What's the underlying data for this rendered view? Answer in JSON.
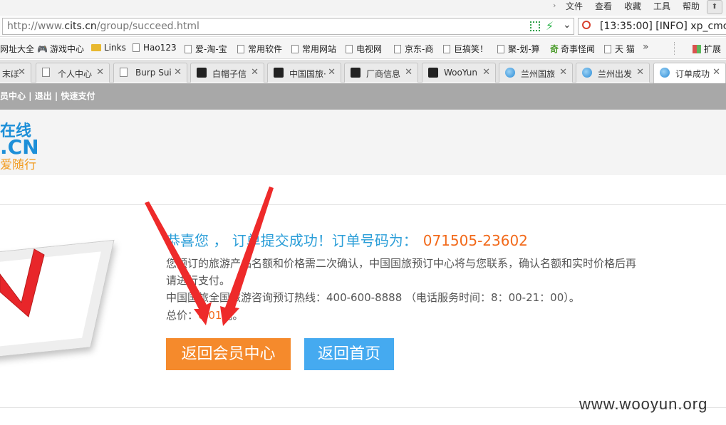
{
  "menu": {
    "items": [
      "文件",
      "查看",
      "收藏",
      "工具",
      "帮助"
    ]
  },
  "address": {
    "url_prefix": "http://www.",
    "url_domain": "cits.cn",
    "url_path": "/group/succeed.html",
    "search_text": "[13:35:00] [INFO] xp_cmc"
  },
  "bookmarks": {
    "items": [
      {
        "label": "网址大全",
        "icon": "none"
      },
      {
        "label": "游戏中心",
        "icon": "gamepad-icon"
      },
      {
        "label": "Links",
        "icon": "folder-icon"
      },
      {
        "label": "Hao123",
        "icon": "page-icon"
      },
      {
        "label": "爱-淘-宝",
        "icon": "page-icon"
      },
      {
        "label": "常用软件",
        "icon": "page-icon"
      },
      {
        "label": "常用网站",
        "icon": "page-icon"
      },
      {
        "label": "电视网",
        "icon": "page-icon"
      },
      {
        "label": "京东-商",
        "icon": "page-icon"
      },
      {
        "label": "巨搞笑！",
        "icon": "page-icon"
      },
      {
        "label": "聚-划-算",
        "icon": "page-icon"
      },
      {
        "label": "奇事怪闻",
        "icon": "qishi-icon"
      },
      {
        "label": "天 猫",
        "icon": "page-icon"
      }
    ],
    "more": "»",
    "extension_label": "扩展"
  },
  "tabs": [
    {
      "label": "末ぼ",
      "icon": "none",
      "active": false
    },
    {
      "label": "个人中心",
      "icon": "page-icon",
      "active": false
    },
    {
      "label": "Burp Sui",
      "icon": "page-icon",
      "active": false
    },
    {
      "label": "白帽子信",
      "icon": "wooyun-icon",
      "active": false
    },
    {
      "label": "中国国旅·",
      "icon": "wooyun-icon",
      "active": false
    },
    {
      "label": "厂商信息",
      "icon": "wooyun-icon",
      "active": false
    },
    {
      "label": "WooYun",
      "icon": "wooyun-icon",
      "active": false
    },
    {
      "label": "兰州国旅",
      "icon": "globe-icon",
      "active": false
    },
    {
      "label": "兰州出发",
      "icon": "globe-icon",
      "active": false
    },
    {
      "label": "订单成功",
      "icon": "globe-icon",
      "active": true
    }
  ],
  "header": {
    "top_links": "员中心 | 退出 | 快速支付",
    "logo_line1": "在线",
    "logo_line2": ".CN",
    "logo_line3": "爱随行"
  },
  "order": {
    "title": "恭喜您 ， 订单提交成功！订单号码为：",
    "order_number": "071505-23602",
    "desc": "您预订的旅游产品名额和价格需二次确认，中国国旅预订中心将与您联系，确认名额和实时价格后再请进行支付。",
    "hotline": "中国国旅全国旅游咨询预订热线：400-600-8888 （电话服务时间：8：00-21：00）。",
    "price_prefix": "总价：",
    "price_amount": "0.01",
    "price_suffix": "元。",
    "btn_member": "返回会员中心",
    "btn_home": "返回首页"
  },
  "watermark": "www.wooyun.org",
  "colors": {
    "accent_orange": "#f26a1b",
    "accent_blue": "#2b9ed8",
    "arrow_red": "#ee2a2a"
  }
}
